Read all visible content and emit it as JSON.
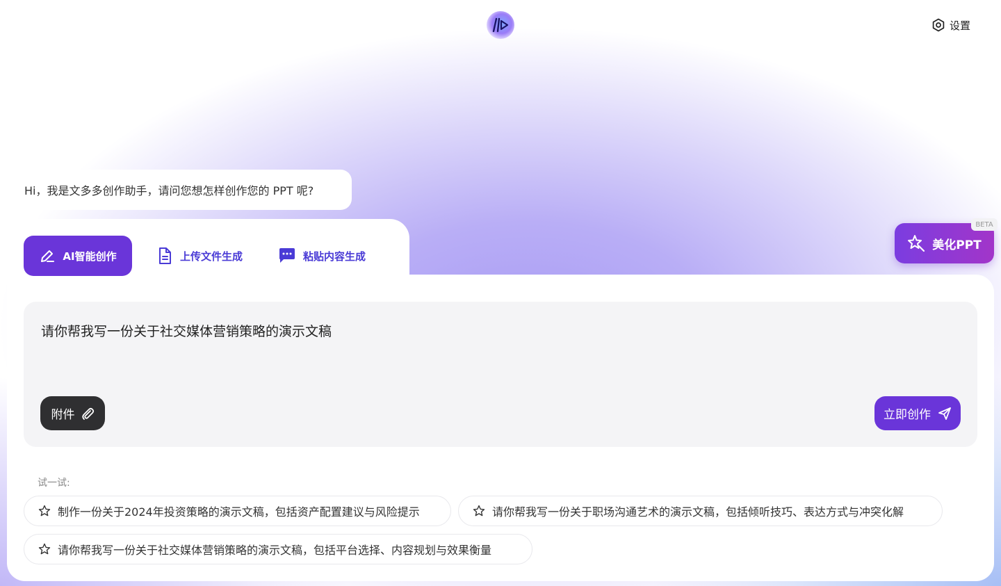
{
  "header": {
    "logo_icon": "code-brackets-logo-icon",
    "settings_label": "设置",
    "settings_icon": "hexagon-gear-icon"
  },
  "greeting": {
    "text": "Hi，我是文多多创作助手，请问您想怎样创作您的 PPT 呢?"
  },
  "tabs": [
    {
      "label": "AI智能创作",
      "icon": "pen-icon",
      "active": true
    },
    {
      "label": "上传文件生成",
      "icon": "document-icon",
      "active": false
    },
    {
      "label": "粘贴内容生成",
      "icon": "chat-bubble-icon",
      "active": false
    }
  ],
  "beautify": {
    "label": "美化PPT",
    "badge": "BETA",
    "icon": "magic-star-icon"
  },
  "input": {
    "value": "请你帮我写一份关于社交媒体营销策略的演示文稿"
  },
  "actions": {
    "attach_label": "附件",
    "attach_icon": "paperclip-icon",
    "create_label": "立即创作",
    "create_icon": "send-icon"
  },
  "suggestions": {
    "label": "试一试:",
    "items": [
      "制作一份关于2024年投资策略的演示文稿，包括资产配置建议与风险提示",
      "请你帮我写一份关于职场沟通艺术的演示文稿，包括倾听技巧、表达方式与冲突化解",
      "请你帮我写一份关于社交媒体营销策略的演示文稿，包括平台选择、内容规划与效果衡量"
    ]
  },
  "colors": {
    "accent": "#6a35d9",
    "tab_text": "#4a3bd6",
    "beautify_gradient_start": "#7b3de0",
    "beautify_gradient_end": "#a235c9",
    "dark_button": "#2f2f31"
  }
}
